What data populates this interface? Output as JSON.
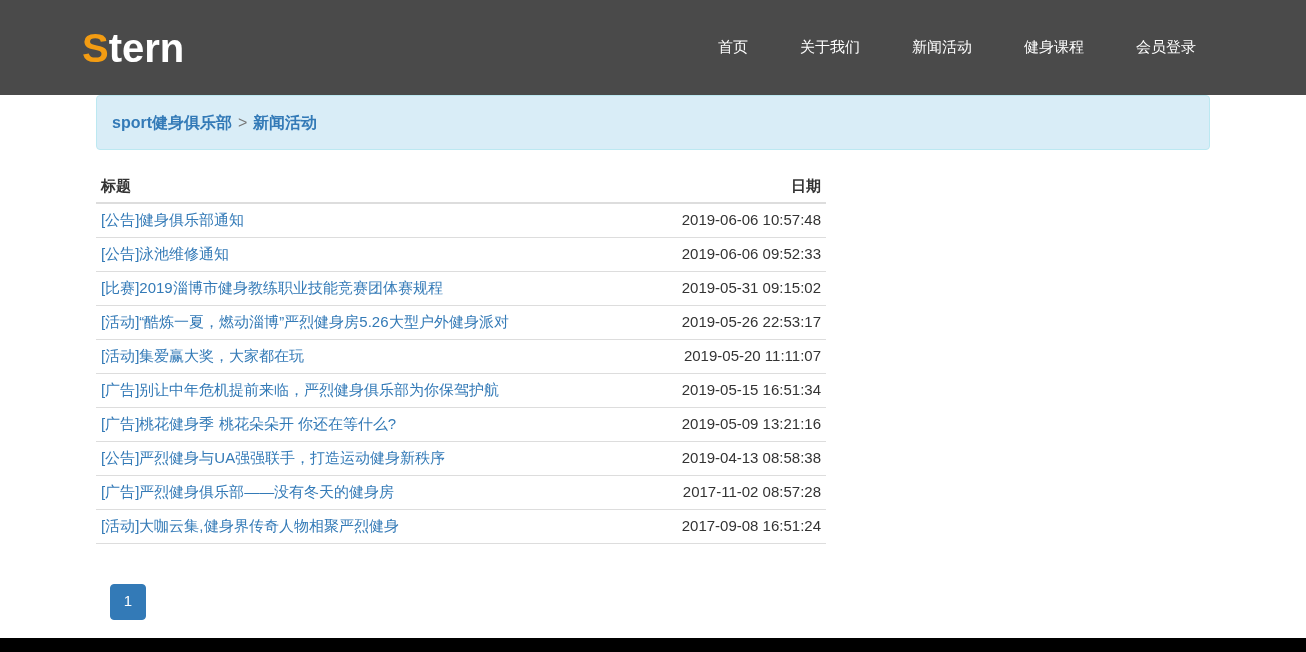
{
  "logo": {
    "accent": "S",
    "rest": "tern"
  },
  "nav": [
    {
      "label": "首页"
    },
    {
      "label": "关于我们"
    },
    {
      "label": "新闻活动"
    },
    {
      "label": "健身课程"
    },
    {
      "label": "会员登录"
    }
  ],
  "breadcrumb": {
    "home": "sport健身俱乐部",
    "separator": ">",
    "current": "新闻活动"
  },
  "table": {
    "columns": [
      "标题",
      "日期"
    ],
    "rows": [
      {
        "title": "[公告]健身俱乐部通知",
        "date": "2019-06-06 10:57:48"
      },
      {
        "title": "[公告]泳池维修通知",
        "date": "2019-06-06 09:52:33"
      },
      {
        "title": "[比赛]2019淄博市健身教练职业技能竞赛团体赛规程",
        "date": "2019-05-31 09:15:02"
      },
      {
        "title": "[活动]“酷炼一夏，燃动淄博”严烈健身房5.26大型户外健身派对",
        "date": "2019-05-26 22:53:17"
      },
      {
        "title": "[活动]集爱赢大奖，大家都在玩",
        "date": "2019-05-20 11:11:07"
      },
      {
        "title": "[广告]别让中年危机提前来临，严烈健身俱乐部为你保驾护航",
        "date": "2019-05-15 16:51:34"
      },
      {
        "title": "[广告]桃花健身季 桃花朵朵开 你还在等什么?",
        "date": "2019-05-09 13:21:16"
      },
      {
        "title": "[公告]严烈健身与UA强强联手，打造运动健身新秩序",
        "date": "2019-04-13 08:58:38"
      },
      {
        "title": "[广告]严烈健身俱乐部——没有冬天的健身房",
        "date": "2017-11-02 08:57:28"
      },
      {
        "title": "[活动]大咖云集,健身界传奇人物相聚严烈健身",
        "date": "2017-09-08 16:51:24"
      }
    ]
  },
  "pagination": [
    {
      "label": "1",
      "selected": true
    }
  ]
}
